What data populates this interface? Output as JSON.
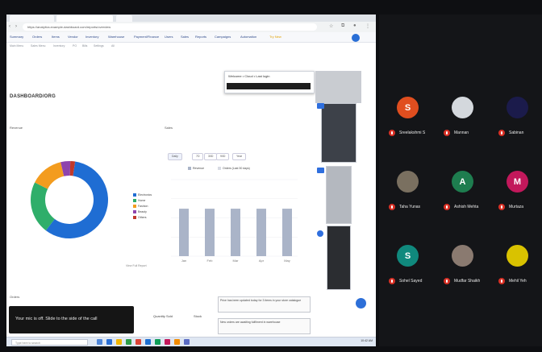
{
  "browser": {
    "url": "https://analytics.example-dashboard.com/reports/overview"
  },
  "nav": {
    "items": [
      "Summary",
      "Orders",
      "Items",
      "Vendor",
      "Inventory",
      "Warehouse",
      "Payment/Finance",
      "Users",
      "Sales",
      "Reports",
      "Campaigns",
      "Automation",
      "Try New"
    ]
  },
  "subnav": {
    "items": [
      "Main Menu",
      "Sales Menu",
      "Inventory",
      "PO",
      "Bills",
      "Settings",
      "All"
    ]
  },
  "page": {
    "title": "DASHBOARD/ORG"
  },
  "popup": {
    "text": "Welcome • Cloud • Last login"
  },
  "sections": {
    "left_label": "Revenue",
    "right_label": "Sales",
    "bottom_left_label": "Orders",
    "view_details": "View Full Report",
    "bottom_mid_label": "Quantity Sold",
    "bottom_right_label": "Stock"
  },
  "chart_tabs": [
    "Daily",
    "7D",
    "30D",
    "90D",
    "Year"
  ],
  "chart_legend": [
    "Revenue",
    "Orders (Last 30 days)"
  ],
  "pie_legend": [
    "Electronics",
    "Home",
    "Fashion",
    "Beauty",
    "Others"
  ],
  "chart_data": [
    {
      "type": "pie",
      "categories": [
        "Electronics",
        "Home",
        "Fashion",
        "Beauty",
        "Others"
      ],
      "values": [
        58,
        22,
        14,
        4,
        2
      ],
      "colors": [
        "#1f6dd3",
        "#2fae6a",
        "#f39c1f",
        "#8e44ad",
        "#c0392b"
      ]
    },
    {
      "type": "bar",
      "categories": [
        "Jan",
        "Feb",
        "Mar",
        "Apr",
        "May"
      ],
      "values": [
        62,
        62,
        62,
        62,
        62
      ],
      "ylim": [
        0,
        100
      ],
      "color": "#aab4c8"
    }
  ],
  "info_boxes": [
    "Price has been updated today for 3 items in your store catalogue",
    "New orders are awaiting fulfilment in warehouse"
  ],
  "toast": {
    "text": "Your mic is off. Slide to the side of the call"
  },
  "taskbar": {
    "search_placeholder": "Type here to search",
    "time": "10:42 AM"
  },
  "meeting": {
    "participants": [
      {
        "initial": "S",
        "name": "Sreelakshmi S",
        "color": "#e04e1f"
      },
      {
        "initial": "",
        "name": "Mannan",
        "color": "#d4d8dd"
      },
      {
        "initial": "",
        "name": "Sabinan",
        "color": "#1b1b4b"
      },
      {
        "initial": "",
        "name": "Taha Yunas",
        "color": "#7a7060"
      },
      {
        "initial": "A",
        "name": "Ashish Mehta",
        "color": "#1e7d4f"
      },
      {
        "initial": "M",
        "name": "Murtaza",
        "color": "#c2185b"
      },
      {
        "initial": "S",
        "name": "Sohel Sayed",
        "color": "#10897d"
      },
      {
        "initial": "",
        "name": "Mudfar Shaikh",
        "color": "#8a7a70"
      },
      {
        "initial": "",
        "name": "Mehil Yeh",
        "color": "#d9c200"
      }
    ]
  }
}
